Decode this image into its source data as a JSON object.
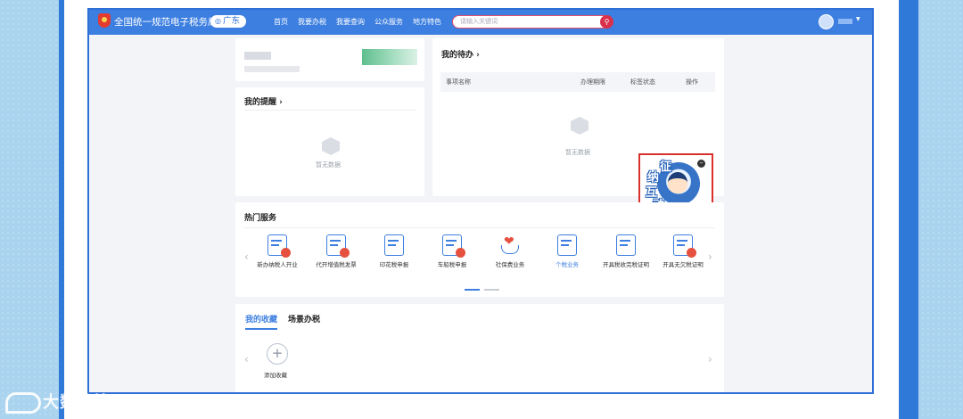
{
  "header": {
    "site_title": "全国统一规范电子税务局",
    "region": "广东",
    "menu": [
      "首页",
      "我要办税",
      "我要查询",
      "公众服务",
      "地方特色"
    ],
    "search_placeholder": "请输入关键词"
  },
  "reminders": {
    "title": "我的提醒 ›",
    "empty_text": "暂无数据"
  },
  "todos": {
    "title": "我的待办 ›",
    "columns": [
      "事项名称",
      "办理期限",
      "标签状态",
      "操作"
    ],
    "empty_text": "暂无数据"
  },
  "floating_widget": {
    "chars": [
      "征",
      "纳",
      "互",
      "动"
    ]
  },
  "hot_services": {
    "title": "热门服务",
    "items": [
      {
        "label": "新办纳税人开业",
        "active": false
      },
      {
        "label": "代开增值税发票",
        "active": false
      },
      {
        "label": "印花税申报",
        "active": false
      },
      {
        "label": "车船税申报",
        "active": false
      },
      {
        "label": "社保费业务",
        "active": false
      },
      {
        "label": "个税业务",
        "active": true
      },
      {
        "label": "开具税收完税证明",
        "active": false
      },
      {
        "label": "开具无欠税证明",
        "active": false
      }
    ]
  },
  "favorites": {
    "tabs": [
      "我的收藏",
      "场景办税"
    ],
    "active_tab": 0,
    "add_label": "添加收藏"
  },
  "watermark": {
    "text": "大数跨境"
  },
  "colors": {
    "nav_blue": "#3d7fe0",
    "frame_blue": "#2f7ad8",
    "alert_red": "#d9302b",
    "page_bg": "#a9d3ee"
  }
}
